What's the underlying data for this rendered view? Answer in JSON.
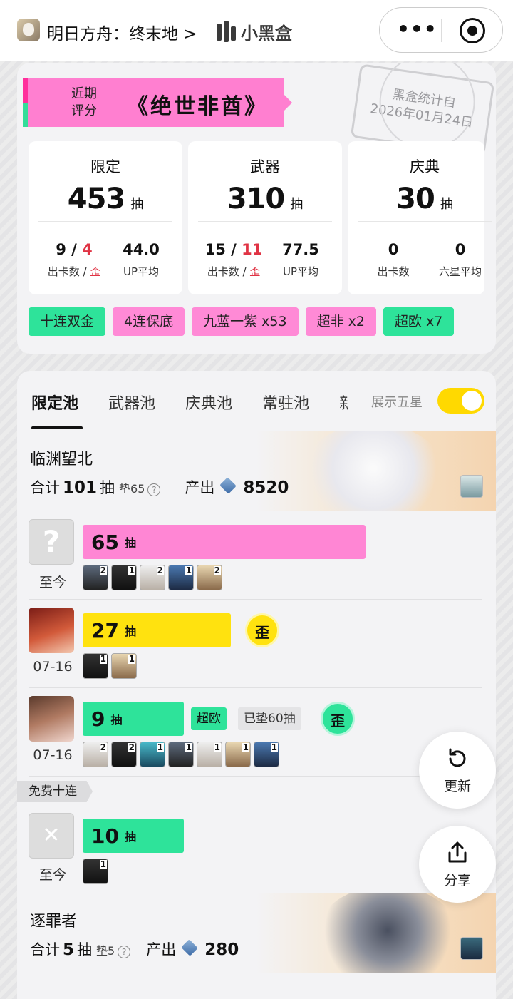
{
  "topbar": {
    "app_name": "明日方舟：终末地 >",
    "logo_text": "小黑盒",
    "menu_icon": "more-dots-icon",
    "close_icon": "target-circle-icon"
  },
  "summary": {
    "rating_label_line1": "近期",
    "rating_label_line2": "评分",
    "rating_title": "《绝世非酋》",
    "stamp_line1": "黑盒统计自",
    "stamp_line2": "2026年01月24日",
    "stats": [
      {
        "title": "限定",
        "count": "453",
        "unit": "抽",
        "v1a": "9",
        "v1sep": " / ",
        "v1b": "4",
        "l1a": "出卡数 / ",
        "l1b": "歪",
        "v2": "44.0",
        "l2": "UP平均"
      },
      {
        "title": "武器",
        "count": "310",
        "unit": "抽",
        "v1a": "15",
        "v1sep": " / ",
        "v1b": "11",
        "l1a": "出卡数 / ",
        "l1b": "歪",
        "v2": "77.5",
        "l2": "UP平均"
      },
      {
        "title": "庆典",
        "count": "30",
        "unit": "抽",
        "v1a": "0",
        "v1sep": "",
        "v1b": "",
        "l1a": "出卡数",
        "l1b": "",
        "v2": "0",
        "l2": "六星平均"
      }
    ],
    "tags": [
      "十连双金",
      "4连保底",
      "九蓝一紫 x53",
      "超非 x2",
      "超欧 x7"
    ]
  },
  "pool": {
    "tabs": [
      "限定池",
      "武器池",
      "庆典池",
      "常驻池",
      "新"
    ],
    "show_five_star": "展示五星",
    "toggle_on": true,
    "banner1": {
      "title": "临渊望北",
      "total_prefix": "合计",
      "total": "101",
      "unit": "抽",
      "pad": "垫65",
      "output_label": "产出",
      "output": "8520"
    },
    "rows": [
      {
        "date": "至今",
        "pulls": "65",
        "unit": "抽",
        "counts": [
          "2",
          "1",
          "2",
          "1",
          "2"
        ]
      },
      {
        "date": "07-16",
        "pulls": "27",
        "unit": "抽",
        "wai": "歪",
        "counts": [
          "1",
          "1"
        ]
      },
      {
        "date": "07-16",
        "pulls": "9",
        "unit": "抽",
        "badge1": "超欧",
        "badge2": "已垫60抽",
        "wai": "歪",
        "counts": [
          "2",
          "2",
          "1",
          "1",
          "1",
          "1",
          "1"
        ]
      }
    ],
    "free_tag": "免费十连",
    "free_row": {
      "date": "至今",
      "pulls": "10",
      "unit": "抽",
      "counts": [
        "1"
      ]
    },
    "banner2": {
      "title": "逐罪者",
      "total_prefix": "合计",
      "total": "5",
      "unit": "抽",
      "pad": "垫5",
      "output_label": "产出",
      "output": "280"
    }
  },
  "fab": {
    "refresh": "更新",
    "share": "分享"
  }
}
